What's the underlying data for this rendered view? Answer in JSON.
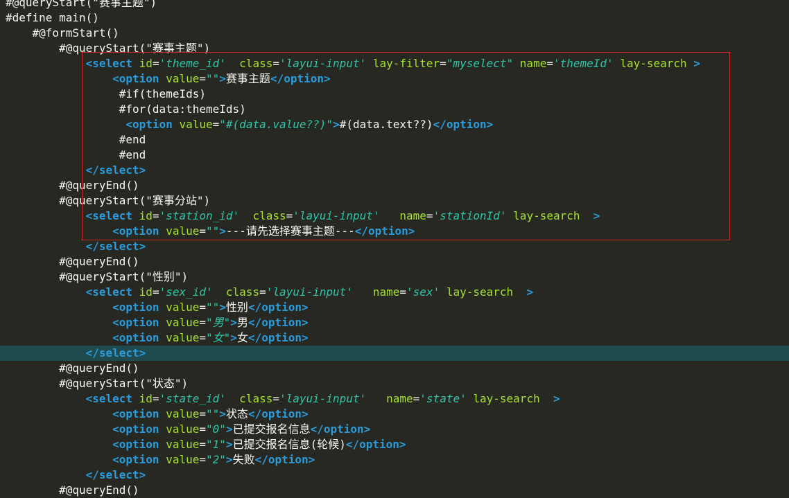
{
  "editor": {
    "lines": [
      {
        "highlight": false,
        "tokens": [
          {
            "t": "plain",
            "v": "#@queryStart(\"赛事主题\")"
          }
        ]
      },
      {
        "highlight": false,
        "tokens": [
          {
            "t": "plain",
            "v": "#define main()"
          }
        ]
      },
      {
        "highlight": false,
        "tokens": [
          {
            "t": "plain",
            "v": "    #@formStart()"
          }
        ]
      },
      {
        "highlight": false,
        "tokens": [
          {
            "t": "plain",
            "v": "        #@queryStart(\"赛事主题\")"
          }
        ]
      },
      {
        "highlight": false,
        "tokens": [
          {
            "t": "plain",
            "v": "            "
          },
          {
            "t": "tag",
            "v": "<select"
          },
          {
            "t": "plain",
            "v": " "
          },
          {
            "t": "attr",
            "v": "id"
          },
          {
            "t": "eq",
            "v": "="
          },
          {
            "t": "str",
            "v": "'theme_id'"
          },
          {
            "t": "plain",
            "v": "  "
          },
          {
            "t": "attr",
            "v": "class"
          },
          {
            "t": "eq",
            "v": "="
          },
          {
            "t": "str",
            "v": "'layui-input'"
          },
          {
            "t": "plain",
            "v": " "
          },
          {
            "t": "attr",
            "v": "lay-filter"
          },
          {
            "t": "eq",
            "v": "="
          },
          {
            "t": "str",
            "v": "\"myselect\""
          },
          {
            "t": "plain",
            "v": " "
          },
          {
            "t": "attr",
            "v": "name"
          },
          {
            "t": "eq",
            "v": "="
          },
          {
            "t": "str",
            "v": "'themeId'"
          },
          {
            "t": "plain",
            "v": " "
          },
          {
            "t": "attr",
            "v": "lay-search"
          },
          {
            "t": "plain",
            "v": " "
          },
          {
            "t": "tag",
            "v": ">"
          }
        ]
      },
      {
        "highlight": false,
        "tokens": [
          {
            "t": "plain",
            "v": "                "
          },
          {
            "t": "tag",
            "v": "<option"
          },
          {
            "t": "plain",
            "v": " "
          },
          {
            "t": "attr",
            "v": "value"
          },
          {
            "t": "eq",
            "v": "="
          },
          {
            "t": "str",
            "v": "\"\""
          },
          {
            "t": "tag",
            "v": ">"
          },
          {
            "t": "text",
            "v": "赛事主题"
          },
          {
            "t": "tag",
            "v": "</option>"
          }
        ]
      },
      {
        "highlight": false,
        "tokens": [
          {
            "t": "plain",
            "v": "                 #if(themeIds)"
          }
        ]
      },
      {
        "highlight": false,
        "tokens": [
          {
            "t": "plain",
            "v": "                 #for(data:themeIds)"
          }
        ]
      },
      {
        "highlight": false,
        "tokens": [
          {
            "t": "plain",
            "v": "                  "
          },
          {
            "t": "tag",
            "v": "<option"
          },
          {
            "t": "plain",
            "v": " "
          },
          {
            "t": "attr",
            "v": "value"
          },
          {
            "t": "eq",
            "v": "="
          },
          {
            "t": "str",
            "v": "\"#(data.value??)\""
          },
          {
            "t": "tag",
            "v": ">"
          },
          {
            "t": "text",
            "v": "#(data.text??)"
          },
          {
            "t": "tag",
            "v": "</option>"
          }
        ]
      },
      {
        "highlight": false,
        "tokens": [
          {
            "t": "plain",
            "v": "                 #end"
          }
        ]
      },
      {
        "highlight": false,
        "tokens": [
          {
            "t": "plain",
            "v": "                 #end"
          }
        ]
      },
      {
        "highlight": false,
        "tokens": [
          {
            "t": "plain",
            "v": "            "
          },
          {
            "t": "tag",
            "v": "</select>"
          }
        ]
      },
      {
        "highlight": false,
        "tokens": [
          {
            "t": "plain",
            "v": "        #@queryEnd()"
          }
        ]
      },
      {
        "highlight": false,
        "tokens": [
          {
            "t": "plain",
            "v": "        #@queryStart(\"赛事分站\")"
          }
        ]
      },
      {
        "highlight": false,
        "tokens": [
          {
            "t": "plain",
            "v": "            "
          },
          {
            "t": "tag",
            "v": "<select"
          },
          {
            "t": "plain",
            "v": " "
          },
          {
            "t": "attr",
            "v": "id"
          },
          {
            "t": "eq",
            "v": "="
          },
          {
            "t": "str",
            "v": "'station_id'"
          },
          {
            "t": "plain",
            "v": "  "
          },
          {
            "t": "attr",
            "v": "class"
          },
          {
            "t": "eq",
            "v": "="
          },
          {
            "t": "str",
            "v": "'layui-input'"
          },
          {
            "t": "plain",
            "v": "   "
          },
          {
            "t": "attr",
            "v": "name"
          },
          {
            "t": "eq",
            "v": "="
          },
          {
            "t": "str",
            "v": "'stationId'"
          },
          {
            "t": "plain",
            "v": " "
          },
          {
            "t": "attr",
            "v": "lay-search"
          },
          {
            "t": "plain",
            "v": "  "
          },
          {
            "t": "tag",
            "v": ">"
          }
        ]
      },
      {
        "highlight": false,
        "tokens": [
          {
            "t": "plain",
            "v": "                "
          },
          {
            "t": "tag",
            "v": "<option"
          },
          {
            "t": "plain",
            "v": " "
          },
          {
            "t": "attr",
            "v": "value"
          },
          {
            "t": "eq",
            "v": "="
          },
          {
            "t": "str",
            "v": "\"\""
          },
          {
            "t": "tag",
            "v": ">"
          },
          {
            "t": "text",
            "v": "---请先选择赛事主题---"
          },
          {
            "t": "tag",
            "v": "</option>"
          }
        ]
      },
      {
        "highlight": false,
        "tokens": [
          {
            "t": "plain",
            "v": "            "
          },
          {
            "t": "tag",
            "v": "</select>"
          }
        ]
      },
      {
        "highlight": false,
        "tokens": [
          {
            "t": "plain",
            "v": "        #@queryEnd()"
          }
        ]
      },
      {
        "highlight": false,
        "tokens": [
          {
            "t": "plain",
            "v": "        #@queryStart(\"性别\")"
          }
        ]
      },
      {
        "highlight": false,
        "tokens": [
          {
            "t": "plain",
            "v": "            "
          },
          {
            "t": "tag",
            "v": "<select"
          },
          {
            "t": "plain",
            "v": " "
          },
          {
            "t": "attr",
            "v": "id"
          },
          {
            "t": "eq",
            "v": "="
          },
          {
            "t": "str",
            "v": "'sex_id'"
          },
          {
            "t": "plain",
            "v": "  "
          },
          {
            "t": "attr",
            "v": "class"
          },
          {
            "t": "eq",
            "v": "="
          },
          {
            "t": "str",
            "v": "'layui-input'"
          },
          {
            "t": "plain",
            "v": "   "
          },
          {
            "t": "attr",
            "v": "name"
          },
          {
            "t": "eq",
            "v": "="
          },
          {
            "t": "str",
            "v": "'sex'"
          },
          {
            "t": "plain",
            "v": " "
          },
          {
            "t": "attr",
            "v": "lay-search"
          },
          {
            "t": "plain",
            "v": "  "
          },
          {
            "t": "tag",
            "v": ">"
          }
        ]
      },
      {
        "highlight": false,
        "tokens": [
          {
            "t": "plain",
            "v": "                "
          },
          {
            "t": "tag",
            "v": "<option"
          },
          {
            "t": "plain",
            "v": " "
          },
          {
            "t": "attr",
            "v": "value"
          },
          {
            "t": "eq",
            "v": "="
          },
          {
            "t": "str",
            "v": "\"\""
          },
          {
            "t": "tag",
            "v": ">"
          },
          {
            "t": "text",
            "v": "性别"
          },
          {
            "t": "tag",
            "v": "</option>"
          }
        ]
      },
      {
        "highlight": false,
        "tokens": [
          {
            "t": "plain",
            "v": "                "
          },
          {
            "t": "tag",
            "v": "<option"
          },
          {
            "t": "plain",
            "v": " "
          },
          {
            "t": "attr",
            "v": "value"
          },
          {
            "t": "eq",
            "v": "="
          },
          {
            "t": "str",
            "v": "\"男\""
          },
          {
            "t": "tag",
            "v": ">"
          },
          {
            "t": "text",
            "v": "男"
          },
          {
            "t": "tag",
            "v": "</option>"
          }
        ]
      },
      {
        "highlight": false,
        "tokens": [
          {
            "t": "plain",
            "v": "                "
          },
          {
            "t": "tag",
            "v": "<option"
          },
          {
            "t": "plain",
            "v": " "
          },
          {
            "t": "attr",
            "v": "value"
          },
          {
            "t": "eq",
            "v": "="
          },
          {
            "t": "str",
            "v": "\"女\""
          },
          {
            "t": "tag",
            "v": ">"
          },
          {
            "t": "text",
            "v": "女"
          },
          {
            "t": "tag",
            "v": "</option>"
          }
        ]
      },
      {
        "highlight": true,
        "tokens": [
          {
            "t": "plain",
            "v": "            "
          },
          {
            "t": "tag",
            "v": "</select>"
          }
        ]
      },
      {
        "highlight": false,
        "tokens": [
          {
            "t": "plain",
            "v": "        #@queryEnd()"
          }
        ]
      },
      {
        "highlight": false,
        "tokens": [
          {
            "t": "plain",
            "v": "        #@queryStart(\"状态\")"
          }
        ]
      },
      {
        "highlight": false,
        "tokens": [
          {
            "t": "plain",
            "v": "            "
          },
          {
            "t": "tag",
            "v": "<select"
          },
          {
            "t": "plain",
            "v": " "
          },
          {
            "t": "attr",
            "v": "id"
          },
          {
            "t": "eq",
            "v": "="
          },
          {
            "t": "str",
            "v": "'state_id'"
          },
          {
            "t": "plain",
            "v": "  "
          },
          {
            "t": "attr",
            "v": "class"
          },
          {
            "t": "eq",
            "v": "="
          },
          {
            "t": "str",
            "v": "'layui-input'"
          },
          {
            "t": "plain",
            "v": "   "
          },
          {
            "t": "attr",
            "v": "name"
          },
          {
            "t": "eq",
            "v": "="
          },
          {
            "t": "str",
            "v": "'state'"
          },
          {
            "t": "plain",
            "v": " "
          },
          {
            "t": "attr",
            "v": "lay-search"
          },
          {
            "t": "plain",
            "v": "  "
          },
          {
            "t": "tag",
            "v": ">"
          }
        ]
      },
      {
        "highlight": false,
        "tokens": [
          {
            "t": "plain",
            "v": "                "
          },
          {
            "t": "tag",
            "v": "<option"
          },
          {
            "t": "plain",
            "v": " "
          },
          {
            "t": "attr",
            "v": "value"
          },
          {
            "t": "eq",
            "v": "="
          },
          {
            "t": "str",
            "v": "\"\""
          },
          {
            "t": "tag",
            "v": ">"
          },
          {
            "t": "text",
            "v": "状态"
          },
          {
            "t": "tag",
            "v": "</option>"
          }
        ]
      },
      {
        "highlight": false,
        "tokens": [
          {
            "t": "plain",
            "v": "                "
          },
          {
            "t": "tag",
            "v": "<option"
          },
          {
            "t": "plain",
            "v": " "
          },
          {
            "t": "attr",
            "v": "value"
          },
          {
            "t": "eq",
            "v": "="
          },
          {
            "t": "str",
            "v": "\"0\""
          },
          {
            "t": "tag",
            "v": ">"
          },
          {
            "t": "text",
            "v": "已提交报名信息"
          },
          {
            "t": "tag",
            "v": "</option>"
          }
        ]
      },
      {
        "highlight": false,
        "tokens": [
          {
            "t": "plain",
            "v": "                "
          },
          {
            "t": "tag",
            "v": "<option"
          },
          {
            "t": "plain",
            "v": " "
          },
          {
            "t": "attr",
            "v": "value"
          },
          {
            "t": "eq",
            "v": "="
          },
          {
            "t": "str",
            "v": "\"1\""
          },
          {
            "t": "tag",
            "v": ">"
          },
          {
            "t": "text",
            "v": "已提交报名信息(轮候)"
          },
          {
            "t": "tag",
            "v": "</option>"
          }
        ]
      },
      {
        "highlight": false,
        "tokens": [
          {
            "t": "plain",
            "v": "                "
          },
          {
            "t": "tag",
            "v": "<option"
          },
          {
            "t": "plain",
            "v": " "
          },
          {
            "t": "attr",
            "v": "value"
          },
          {
            "t": "eq",
            "v": "="
          },
          {
            "t": "str",
            "v": "\"2\""
          },
          {
            "t": "tag",
            "v": ">"
          },
          {
            "t": "text",
            "v": "失败"
          },
          {
            "t": "tag",
            "v": "</option>"
          }
        ]
      },
      {
        "highlight": false,
        "tokens": [
          {
            "t": "plain",
            "v": "            "
          },
          {
            "t": "tag",
            "v": "</select>"
          }
        ]
      },
      {
        "highlight": false,
        "tokens": [
          {
            "t": "plain",
            "v": "        #@queryEnd()"
          }
        ]
      }
    ]
  },
  "colors": {
    "background": "#272822",
    "tag": "#2a9bdb",
    "attribute": "#a6e22e",
    "string": "#2fc4a8",
    "text": "#f8f8f2",
    "current_line": "#1e4a50",
    "annotation_box": "#d6282b"
  }
}
